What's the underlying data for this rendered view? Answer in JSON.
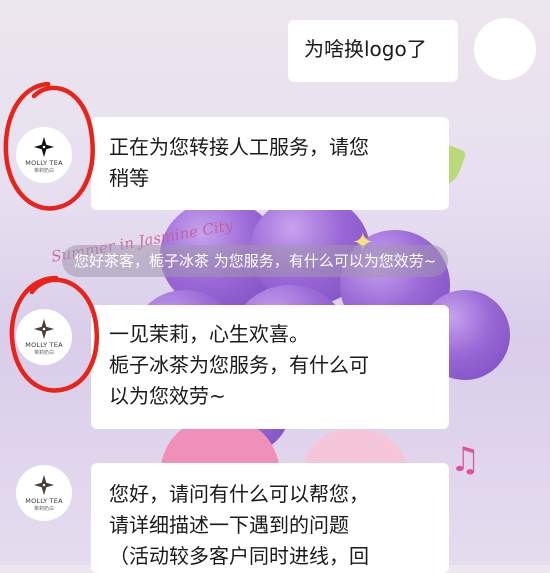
{
  "chat": {
    "user_message": "为啥换logo了",
    "bot_reply_1": [
      "正在为您转接人工服务，请您",
      "稍等"
    ],
    "system_notice": "您好茶客，栀子冰茶 为您服务，有什么可以为您效劳~",
    "bot_reply_2": [
      "一见茉莉，心生欢喜。",
      "栀子冰茶为您服务，有什么可",
      "以为您效劳~"
    ],
    "bot_reply_3": [
      "您好，请问有什么可以帮您，",
      "请详细描述一下遇到的问题",
      "（活动较多客户同时进线，回"
    ]
  },
  "avatar": {
    "brand": "MOLLY TEA",
    "brand_sub": "茉莉奶白"
  },
  "background": {
    "script_text": "Summer in Jasmine City"
  },
  "icons": {
    "music": "music-note-icon",
    "star": "star-icon",
    "logo": "four-petal-logo-icon"
  },
  "colors": {
    "annotation_red": "#e8231a",
    "bubble_bg": "#ffffff"
  }
}
